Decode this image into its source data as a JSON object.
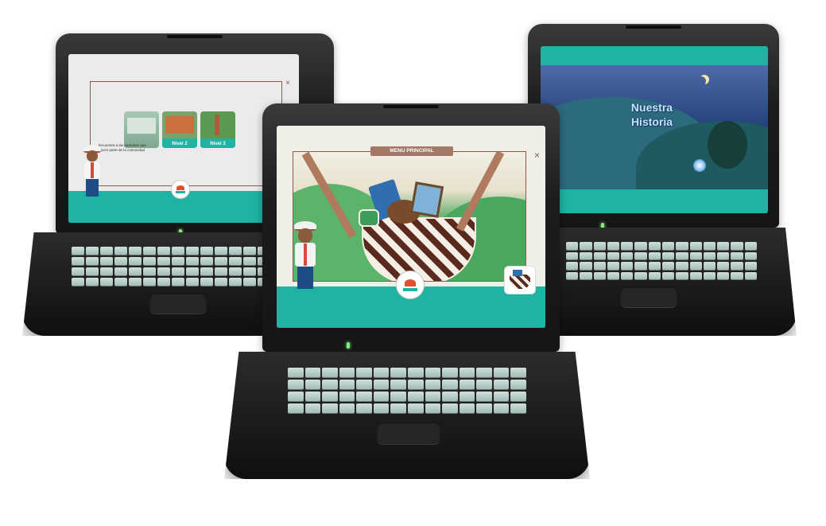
{
  "left_screen": {
    "instruction_text": "Encuentra a las personas que hacen parte de la comunidad",
    "level_cards": [
      {
        "label": ""
      },
      {
        "label": "Nivel 2"
      },
      {
        "label": "Nivel 3"
      }
    ],
    "close_symbol": "×"
  },
  "center_screen": {
    "menu_title": "MENU PRINCIPAL",
    "close_symbol": "×"
  },
  "right_screen": {
    "title_line1": "Nuestra",
    "title_line2": "Historia"
  },
  "colors": {
    "teal": "#1fb3a3",
    "frame_brown": "#8a5a4a",
    "night_sky": "#1f3f72",
    "green_hills": "#3fa55a"
  },
  "icons": [
    "close-icon",
    "character-icon",
    "logo-icon",
    "thumbnail-icon"
  ]
}
